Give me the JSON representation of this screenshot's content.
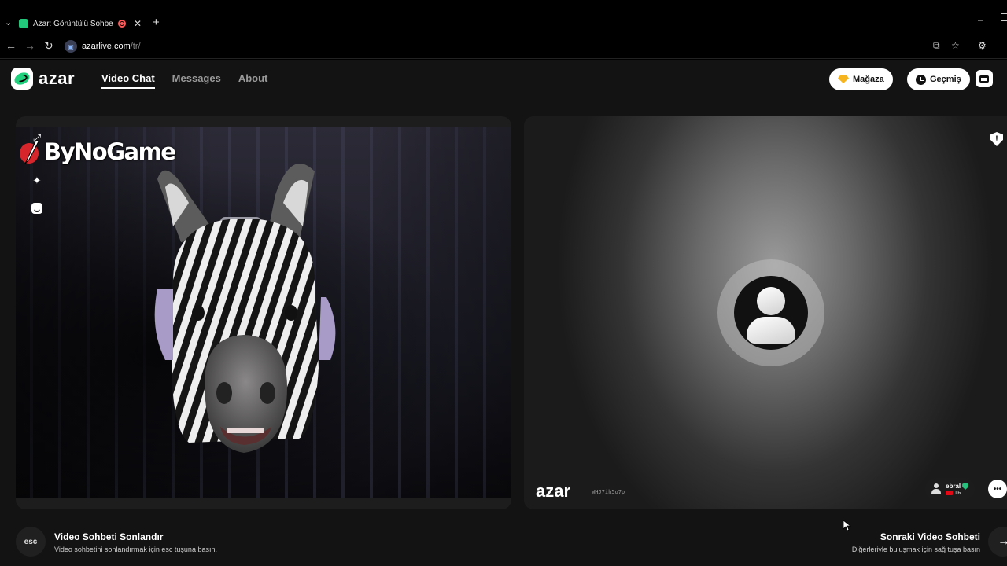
{
  "browser": {
    "tab_title": "Azar: Görüntülü Sohbet & Y",
    "url_host": "azarlive.com",
    "url_path": "/tr/"
  },
  "header": {
    "logo_text": "azar",
    "nav": [
      "Video Chat",
      "Messages",
      "About"
    ],
    "store_label": "Mağaza",
    "history_label": "Geçmiş"
  },
  "left_video": {
    "watermark": "ByNoGame"
  },
  "right_video": {
    "logo_text": "azar",
    "session_id": "WHJ7ih5o7p",
    "peer_name": "ebral",
    "peer_country": "TR"
  },
  "footer": {
    "esc_key": "esc",
    "end_title": "Video Sohbeti Sonlandır",
    "end_sub": "Video sohbetini sonlandırmak için esc tuşuna basın.",
    "next_title": "Sonraki Video Sohbeti",
    "next_sub": "Diğerleriyle buluşmak için sağ tuşa basın",
    "arrow_key": "→"
  },
  "colors": {
    "brand_green": "#1fd07c",
    "diamond": "#f6b51e",
    "record_red": "#ff5a5a"
  }
}
